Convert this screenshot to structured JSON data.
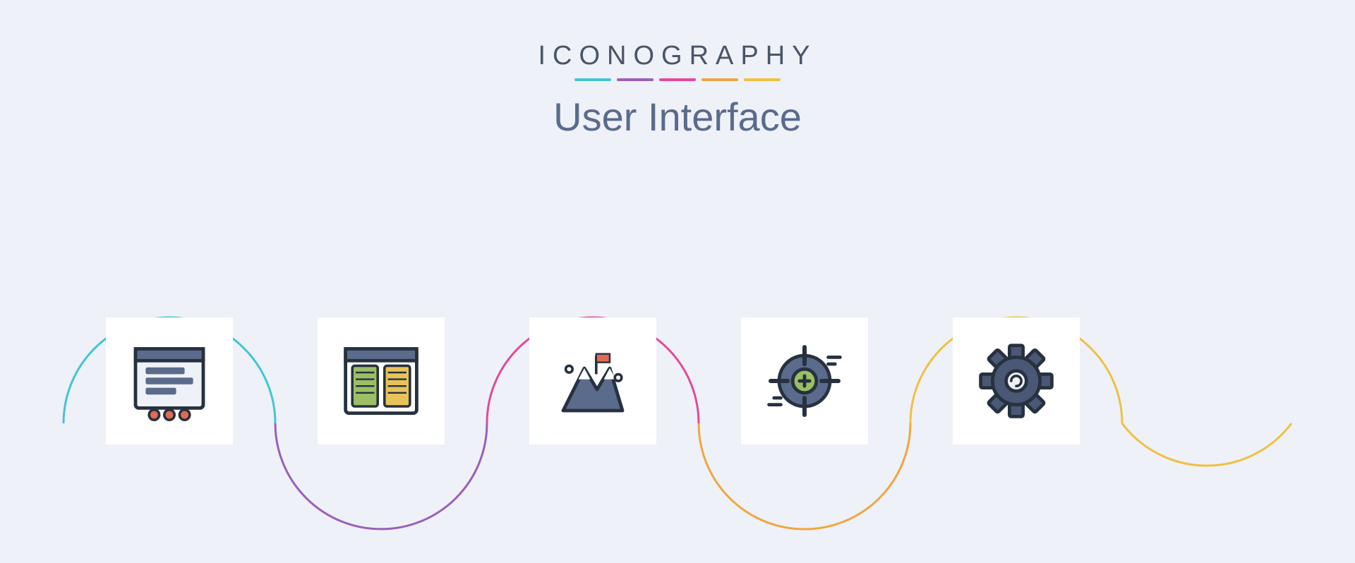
{
  "header": {
    "brand": "ICONOGRAPHY",
    "title": "User Interface"
  },
  "underline_colors": [
    "#41c5d4",
    "#9b5fb9",
    "#e4499a",
    "#f0a642",
    "#f0c042"
  ],
  "wave_colors": {
    "segment1": "#41c5d4",
    "segment2": "#9b5fb9",
    "segment3": "#e4499a",
    "segment4": "#f0a642",
    "segment5": "#f0c042"
  },
  "icons": [
    {
      "name": "browser-form-icon",
      "label": "Browser form window"
    },
    {
      "name": "browser-columns-icon",
      "label": "Browser two-column layout"
    },
    {
      "name": "mountain-flag-icon",
      "label": "Mountain with flag (achievement)"
    },
    {
      "name": "target-icon",
      "label": "Target / crosshair"
    },
    {
      "name": "gear-icon",
      "label": "Settings gear"
    }
  ]
}
